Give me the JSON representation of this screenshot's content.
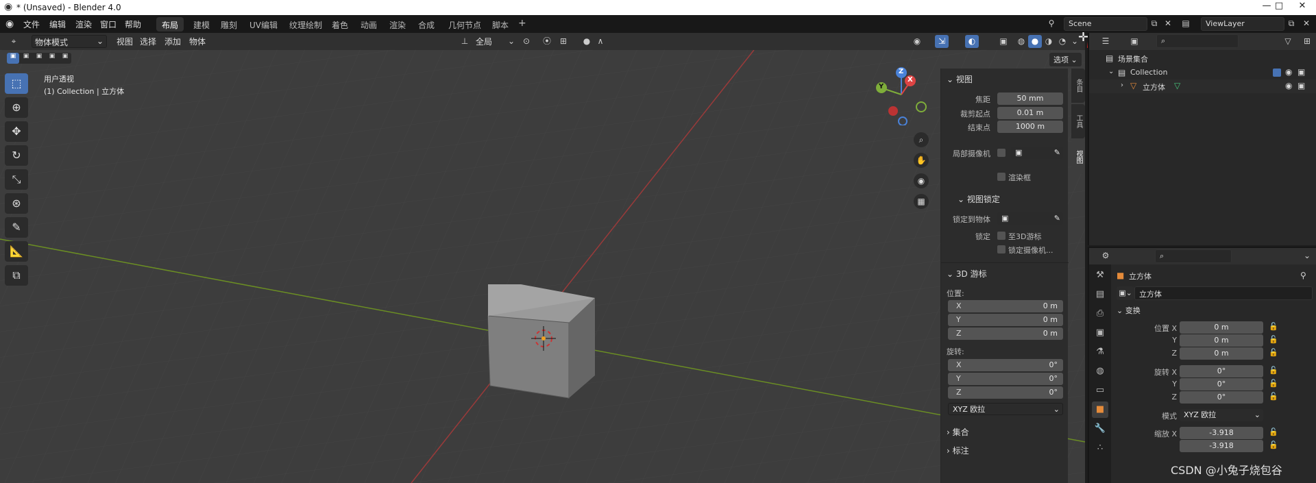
{
  "window": {
    "title": "* (Unsaved) - Blender 4.0",
    "min": "—",
    "max": "□",
    "close": "✕"
  },
  "menu": {
    "items": [
      "文件",
      "编辑",
      "渲染",
      "窗口",
      "帮助"
    ]
  },
  "workspaces": {
    "tabs": [
      "布局",
      "建模",
      "雕刻",
      "UV编辑",
      "纹理绘制",
      "着色",
      "动画",
      "渲染",
      "合成",
      "几何节点",
      "脚本"
    ],
    "add": "+",
    "active": 0
  },
  "scene": {
    "name": "Scene",
    "view_layer": "ViewLayer"
  },
  "header3d": {
    "mode": "物体模式",
    "menus": [
      "视图",
      "选择",
      "添加",
      "物体"
    ],
    "transform": "全局",
    "options": "选项"
  },
  "viewport": {
    "view_name": "用户透视",
    "collection_info": "(1) Collection | 立方体"
  },
  "gizmo": {
    "x": "X",
    "y": "Y",
    "z": "Z"
  },
  "npanel": {
    "tabs": [
      "条目",
      "工具",
      "视图"
    ],
    "view_section": "视图",
    "focal_label": "焦距",
    "focal": "50 mm",
    "clip_start_label": "裁剪起点",
    "clip_start": "0.01 m",
    "clip_end_label": "结束点",
    "clip_end": "1000 m",
    "local_camera_label": "局部摄像机",
    "render_region": "渲染框",
    "view_lock_section": "视图锁定",
    "lock_object_label": "锁定到物体",
    "lock_label": "锁定",
    "lock_cursor": "至3D游标",
    "lock_camera": "锁定摄像机...",
    "cursor_section": "3D 游标",
    "location_label": "位置:",
    "rotation_label": "旋转:",
    "x": "X",
    "y": "Y",
    "z": "Z",
    "loc": [
      "0 m",
      "0 m",
      "0 m"
    ],
    "rot": [
      "0°",
      "0°",
      "0°"
    ],
    "rot_mode": "XYZ 欧拉",
    "collection_section": "集合",
    "annotation_section": "标注"
  },
  "outliner": {
    "scene_collection": "场景集合",
    "collection": "Collection",
    "object": "立方体"
  },
  "properties": {
    "object_name": "立方体",
    "object_field": "立方体",
    "transform_section": "变换",
    "loc_label": "位置 X",
    "y": "Y",
    "z": "Z",
    "loc": [
      "0 m",
      "0 m",
      "0 m"
    ],
    "rot_label": "旋转 X",
    "rot": [
      "0°",
      "0°",
      "0°"
    ],
    "mode_label": "模式",
    "mode": "XYZ 欧拉",
    "scale_label": "缩放 X",
    "scale": [
      "-3.918",
      "-3.918"
    ]
  },
  "watermark": "CSDN @小兔子烧包谷"
}
